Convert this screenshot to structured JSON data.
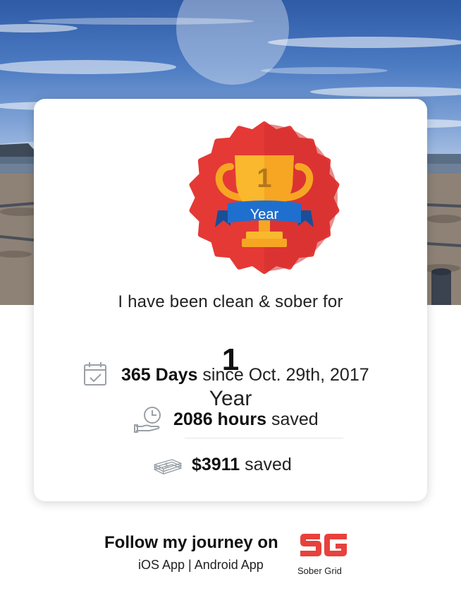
{
  "badge": {
    "number": "1",
    "ribbon_label": "Year",
    "colors": {
      "seal": "#e53935",
      "trophy": "#f9b82e",
      "ribbon": "#1f6fcf"
    }
  },
  "headline": "I have been clean & sober for",
  "duration": {
    "value": "1",
    "unit": "Year"
  },
  "stats": {
    "days": {
      "bold": "365 Days",
      "rest": " since Oct. 29th, 2017",
      "icon": "calendar-check-icon"
    },
    "hours": {
      "bold": "2086 hours",
      "rest": " saved",
      "icon": "clock-hand-icon"
    },
    "money": {
      "bold": "$3911",
      "rest": " saved",
      "icon": "money-stack-icon"
    }
  },
  "footer": {
    "follow_text": "Follow my journey on",
    "ios_link": "iOS App",
    "separator": " | ",
    "android_link": "Android App",
    "logo_caption": "Sober Grid",
    "logo_color": "#e8413c"
  }
}
